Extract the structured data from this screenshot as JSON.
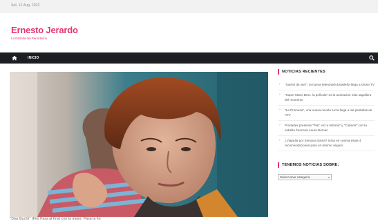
{
  "topbar": {
    "date": "Sat, 12 Aug, 2022"
  },
  "site": {
    "title": "Ernesto Jerardo",
    "tagline": "La Estrella del Periodismo"
  },
  "nav": {
    "home_label": "INICIO"
  },
  "colors": {
    "accent": "#e6366f",
    "nav_bg": "#1c1e24",
    "topbar_bg": "#f2f2f2"
  },
  "icons": {
    "home": "home-icon",
    "search": "search-icon"
  },
  "main": {
    "caption": "\"Diaz Bucht\" (Fin) Pasa al final con la mejor: Pasa la fin"
  },
  "sidebar": {
    "recent_title": "NOTICIAS RECIENTES",
    "recent": [
      {
        "text": "\"Suerte de vivir\", la nueva telenovela brasileña llega a Glose TV"
      },
      {
        "text": "\"Super Mario Bros. la película\" es la animación más taquillera del momento"
      },
      {
        "text": "\"La Promesa\", una nueva novela turca llega a las pantallas de ATV"
      },
      {
        "text": "Prodarles presenta \"Piaf: voz e historia\" y \"Cabaret\" con la estrella francesa Laura Bornac"
      },
      {
        "text": "¿Viajarás por Semana Santa? toma en cuenta estas 4 recomendaciones para un retorno seguro"
      }
    ],
    "categories_title": "TENEMOS NOTICIAS SOBRE:",
    "category_select": "Seleccionar categoría"
  }
}
